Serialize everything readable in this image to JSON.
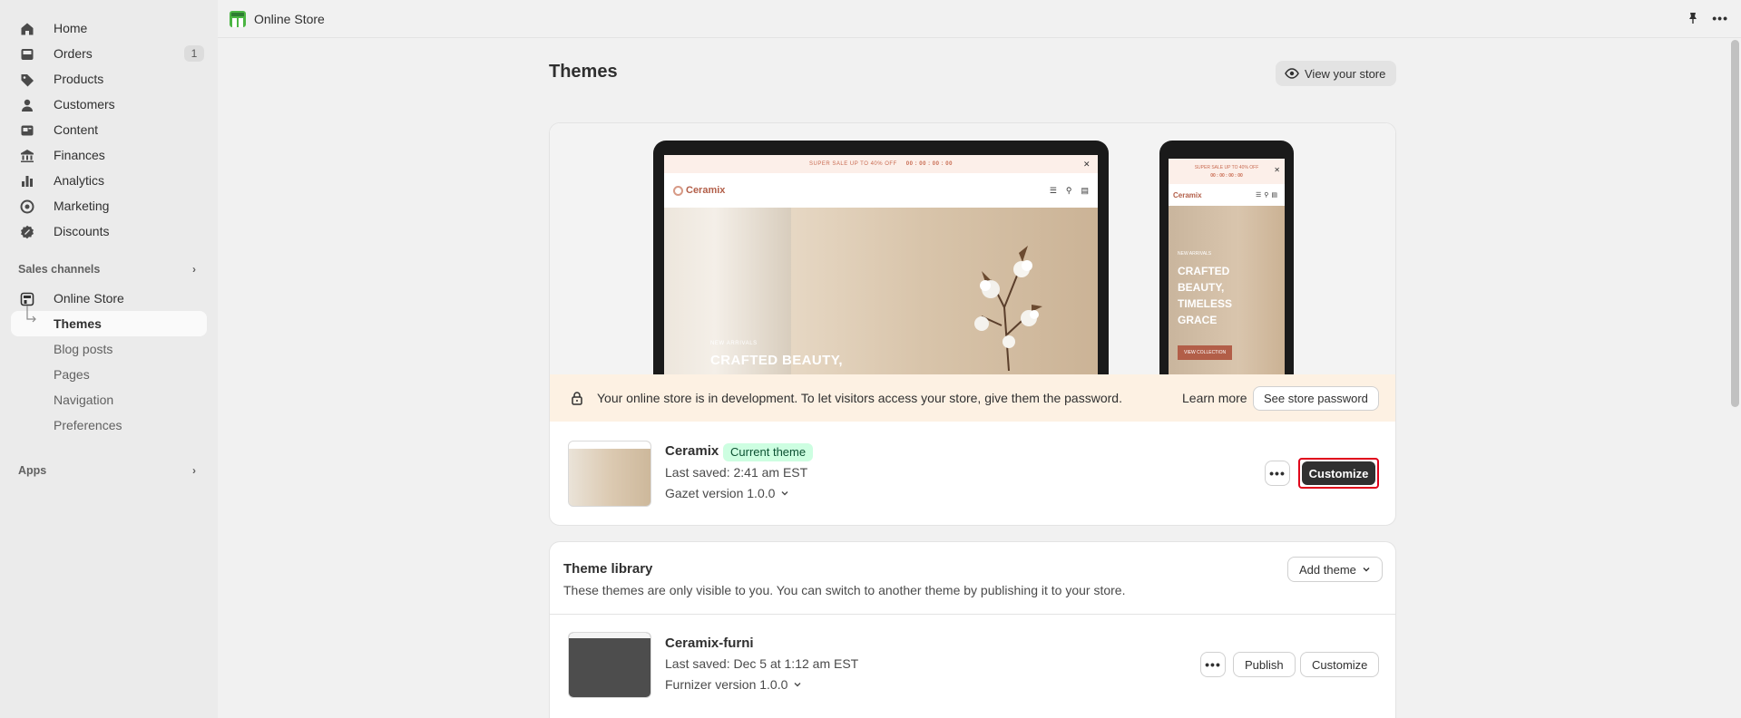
{
  "sidebar": {
    "items": [
      {
        "label": "Home",
        "icon": "home-icon"
      },
      {
        "label": "Orders",
        "icon": "orders-icon",
        "count": "1"
      },
      {
        "label": "Products",
        "icon": "tag-icon"
      },
      {
        "label": "Customers",
        "icon": "person-icon"
      },
      {
        "label": "Content",
        "icon": "content-icon"
      },
      {
        "label": "Finances",
        "icon": "bank-icon"
      },
      {
        "label": "Analytics",
        "icon": "bar-chart-icon"
      },
      {
        "label": "Marketing",
        "icon": "target-icon"
      },
      {
        "label": "Discounts",
        "icon": "discount-icon"
      }
    ],
    "sales_channels_label": "Sales channels",
    "online_store_label": "Online Store",
    "sub_items": [
      "Themes",
      "Blog posts",
      "Pages",
      "Navigation",
      "Preferences"
    ],
    "apps_label": "Apps"
  },
  "topbar": {
    "title": "Online Store"
  },
  "page": {
    "title": "Themes",
    "view_store_label": "View your store"
  },
  "preview": {
    "promo_text": "SUPER SALE UP TO 40% OFF",
    "countdown": "00 : 00 : 00 : 00",
    "brand": "Ceramix",
    "hero_kicker": "NEW ARRIVALS",
    "hero_title": "CRAFTED BEAUTY,",
    "phone_title": "CRAFTED BEAUTY, TIMELESS GRACE",
    "phone_cta": "VIEW COLLECTION"
  },
  "notice": {
    "text": "Your online store is in development. To let visitors access your store, give them the password.",
    "learn_more": "Learn more",
    "button": "See store password"
  },
  "current_theme": {
    "name": "Ceramix",
    "badge": "Current theme",
    "last_saved": "Last saved: 2:41 am EST",
    "version": "Gazet version 1.0.0",
    "more_label": "•••",
    "customize_label": "Customize"
  },
  "library": {
    "title": "Theme library",
    "description": "These themes are only visible to you. You can switch to another theme by publishing it to your store.",
    "add_theme_label": "Add theme",
    "themes": [
      {
        "name": "Ceramix-furni",
        "last_saved": "Last saved: Dec 5 at 1:12 am EST",
        "version": "Furnizer version 1.0.0",
        "publish_label": "Publish",
        "customize_label": "Customize",
        "more_label": "•••"
      }
    ]
  }
}
